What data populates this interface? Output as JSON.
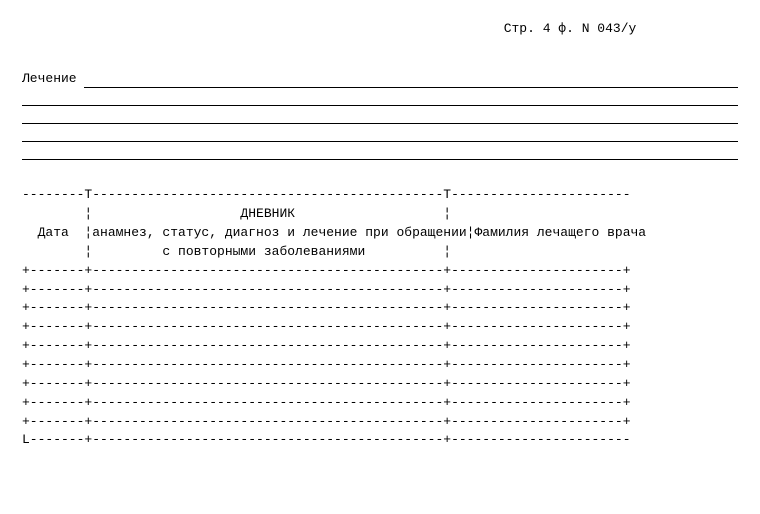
{
  "header": "Стр. 4 ф. N 043/у",
  "treatment_label": "Лечение ",
  "ascii_table": "--------T---------------------------------------------T-----------------------\n        ¦                   ДНЕВНИК                   ¦\n  Дата  ¦анамнез, статус, диагноз и лечение при обращении¦Фамилия лечащего врача\n        ¦         с повторными заболеваниями          ¦\n+-------+---------------------------------------------+----------------------+\n+-------+---------------------------------------------+----------------------+\n+-------+---------------------------------------------+----------------------+\n+-------+---------------------------------------------+----------------------+\n+-------+---------------------------------------------+----------------------+\n+-------+---------------------------------------------+----------------------+\n+-------+---------------------------------------------+----------------------+\n+-------+---------------------------------------------+----------------------+\n+-------+---------------------------------------------+----------------------+\nL-------+---------------------------------------------+-----------------------"
}
